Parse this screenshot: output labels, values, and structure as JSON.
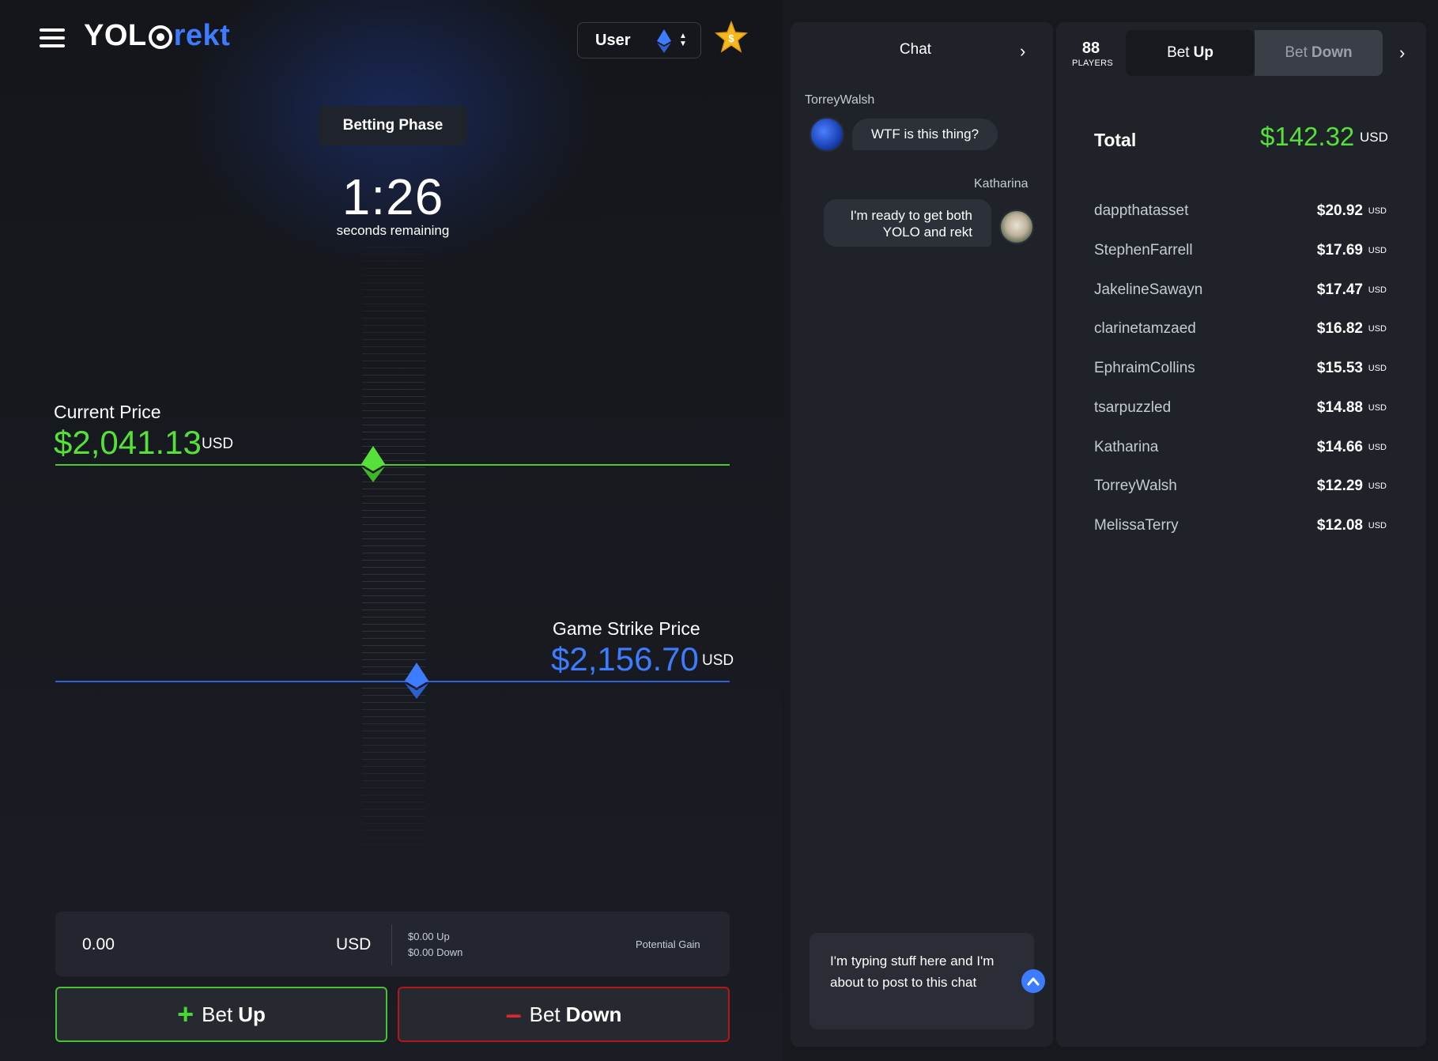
{
  "header": {
    "logo_left": "YOL",
    "logo_right": "rekt",
    "user_label": "User"
  },
  "game": {
    "phase": "Betting Phase",
    "countdown": "1:26",
    "countdown_sub": "seconds remaining",
    "current_label": "Current Price",
    "current_price": "$2,041.13",
    "current_unit": "USD",
    "strike_label": "Game Strike Price",
    "strike_price": "$2,156.70",
    "strike_unit": "USD",
    "colors": {
      "up": "#55e03a",
      "strike": "#3d7bff",
      "down": "#e0262b"
    }
  },
  "bet_form": {
    "amount": "0.00",
    "currency": "USD",
    "up_line": "$0.00 Up",
    "down_line": "$0.00 Down",
    "gain_label": "Potential Gain",
    "bet_up_pre": "Bet",
    "bet_up_strong": "Up",
    "bet_down_pre": "Bet",
    "bet_down_strong": "Down"
  },
  "chat": {
    "title": "Chat",
    "messages": [
      {
        "name": "TorreyWalsh",
        "text": "WTF is this thing?"
      },
      {
        "name": "Katharina",
        "text_line1": "I'm ready to get both",
        "text_line2": "YOLO and rekt"
      }
    ],
    "draft": "I'm typing stuff here and I'm about to post to this chat"
  },
  "bets": {
    "players_count": "88",
    "players_label": "PLAYERS",
    "tab_up_pre": "Bet",
    "tab_up_strong": "Up",
    "tab_down_pre": "Bet",
    "tab_down_strong": "Down",
    "total_label": "Total",
    "total_amount": "$142.32",
    "total_unit": "USD",
    "rows": [
      {
        "name": "dappthatasset",
        "amount": "$20.92",
        "unit": "USD"
      },
      {
        "name": "StephenFarrell",
        "amount": "$17.69",
        "unit": "USD"
      },
      {
        "name": "JakelineSawayn",
        "amount": "$17.47",
        "unit": "USD"
      },
      {
        "name": "clarinetamzaed",
        "amount": "$16.82",
        "unit": "USD"
      },
      {
        "name": "EphraimCollins",
        "amount": "$15.53",
        "unit": "USD"
      },
      {
        "name": "tsarpuzzled",
        "amount": "$14.88",
        "unit": "USD"
      },
      {
        "name": "Katharina",
        "amount": "$14.66",
        "unit": "USD"
      },
      {
        "name": "TorreyWalsh",
        "amount": "$12.29",
        "unit": "USD"
      },
      {
        "name": "MelissaTerry",
        "amount": "$12.08",
        "unit": "USD"
      }
    ]
  }
}
